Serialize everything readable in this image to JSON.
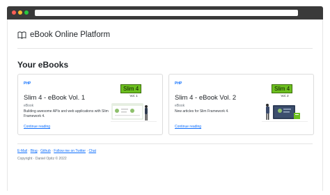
{
  "colors": {
    "link": "#0d6efd",
    "badge_green": "#6cbf1f",
    "text": "#212529",
    "muted": "#6c757d"
  },
  "header": {
    "title": "eBook Online Platform",
    "icon": "book-icon"
  },
  "section": {
    "title": "Your eBooks"
  },
  "books": [
    {
      "tag": "PHP",
      "title": "Slim 4 - eBook Vol. 1",
      "subtitle": "eBook",
      "description": "Building awesome APIs and web applications with Slim Framework 4.",
      "link": "Continue reading",
      "cover_badge": "Slim 4",
      "cover_vol": "Vol. 1"
    },
    {
      "tag": "PHP",
      "title": "Slim 4 - eBook Vol. 2",
      "subtitle": "eBook",
      "description": "New articles for Slim Framework 4.",
      "link": "Continue reading",
      "cover_badge": "Slim 4",
      "cover_vol": "Vol. 2"
    }
  ],
  "footer": {
    "links": [
      "E-Mail",
      "Blog",
      "Github",
      "Follow me on Twitter",
      "Chat"
    ],
    "separator": "·",
    "copyright": "Copyright · Daniel Opitz © 2022"
  }
}
